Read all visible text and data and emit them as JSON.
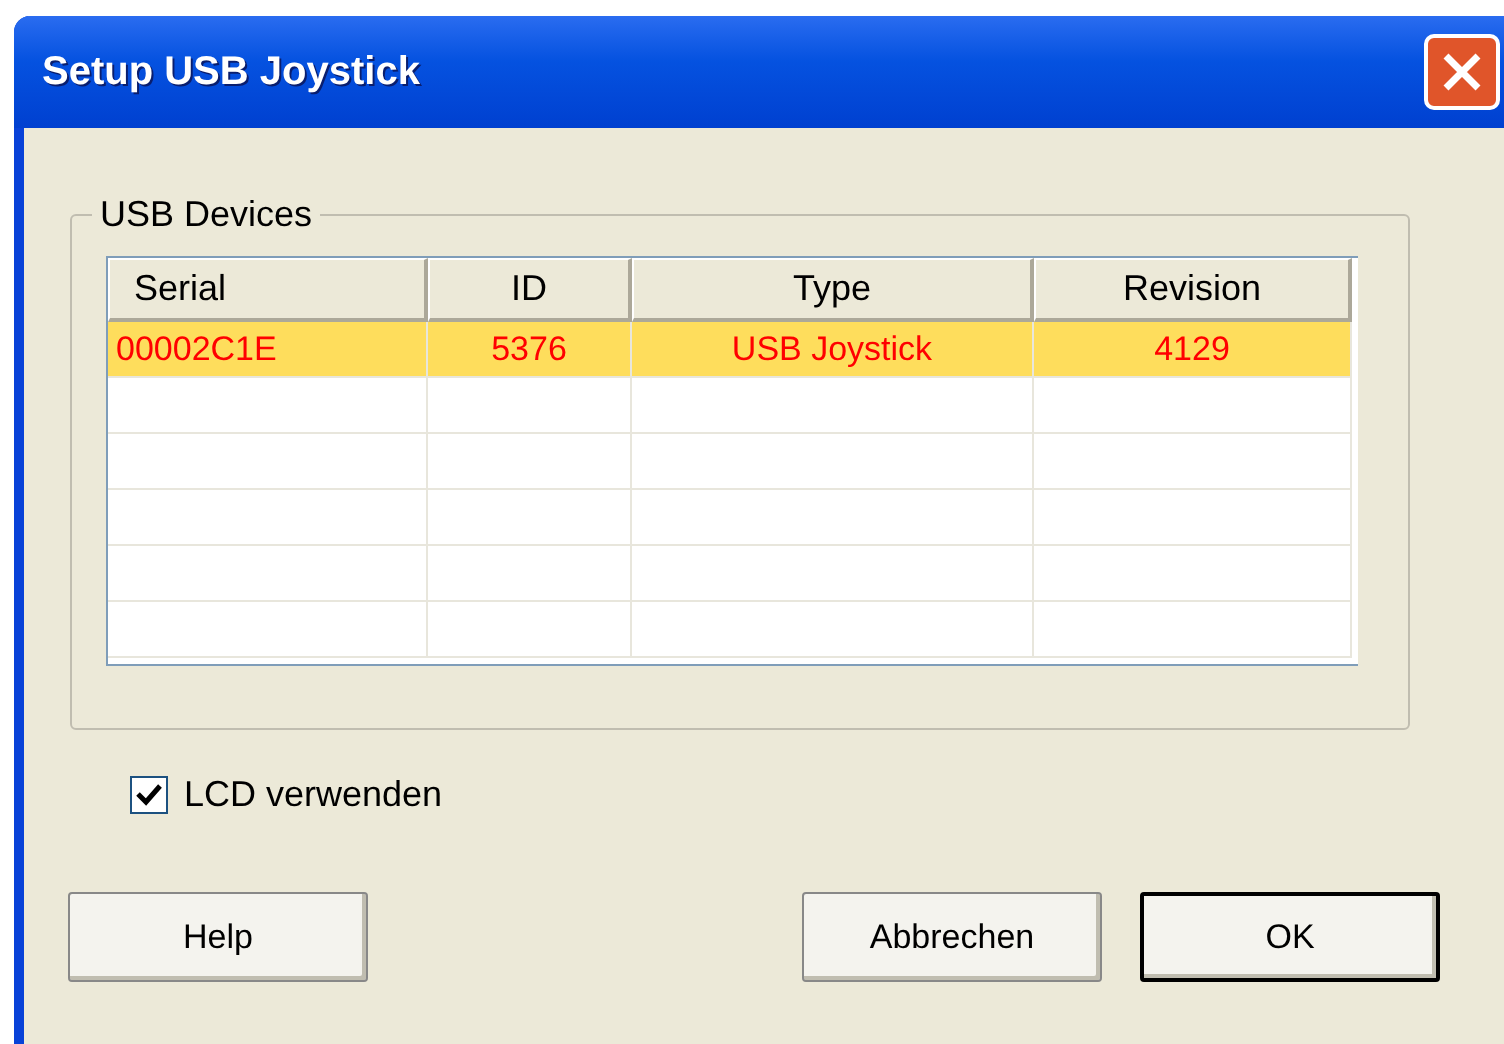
{
  "window": {
    "title": "Setup USB Joystick"
  },
  "group": {
    "title": "USB Devices"
  },
  "table": {
    "columns": [
      "Serial",
      "ID",
      "Type",
      "Revision"
    ],
    "rows": [
      {
        "cells": [
          "00002C1E",
          "5376",
          "USB Joystick",
          "4129"
        ],
        "selected": true
      }
    ]
  },
  "checkbox": {
    "label": "LCD verwenden",
    "checked": true
  },
  "buttons": [
    {
      "label": "Help",
      "default": false
    },
    {
      "label": "Abbrechen",
      "default": false
    },
    {
      "label": "OK",
      "default": true
    }
  ]
}
